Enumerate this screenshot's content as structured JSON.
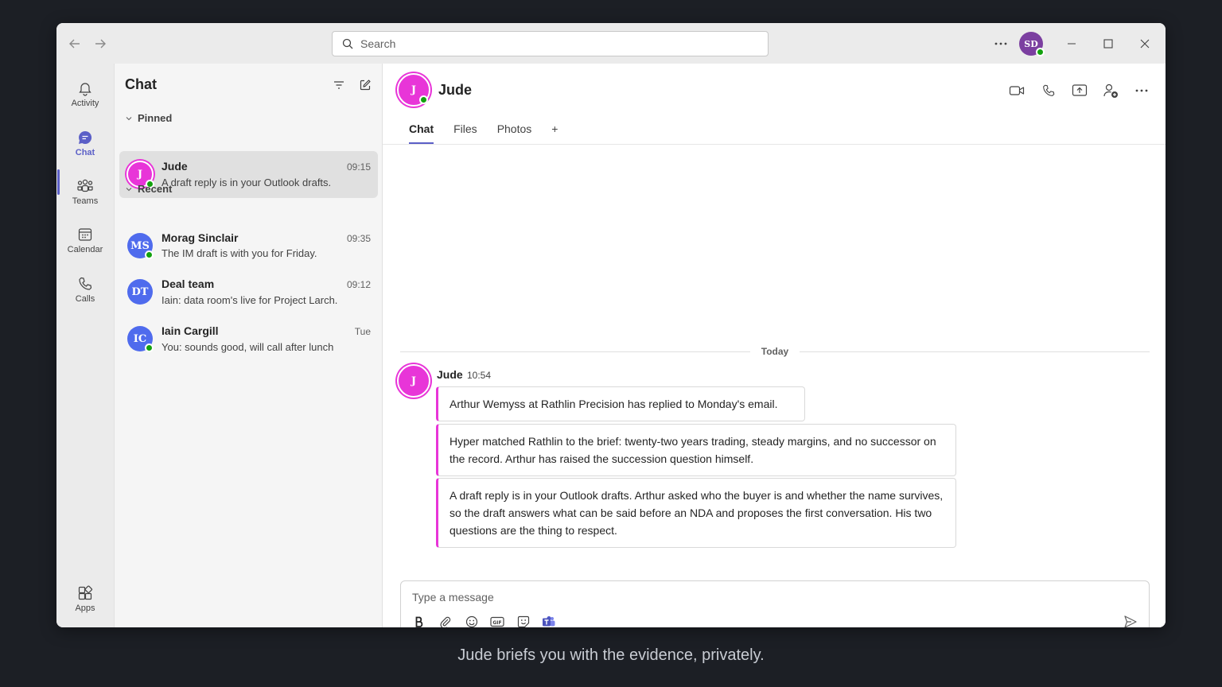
{
  "search": {
    "placeholder": "Search"
  },
  "user": {
    "initials": "SD"
  },
  "rail": {
    "items": [
      {
        "label": "Activity",
        "icon": "bell-icon"
      },
      {
        "label": "Chat",
        "icon": "chat-icon"
      },
      {
        "label": "Teams",
        "icon": "teams-icon"
      },
      {
        "label": "Calendar",
        "icon": "calendar-icon"
      },
      {
        "label": "Calls",
        "icon": "phone-icon"
      },
      {
        "label": "Apps",
        "icon": "apps-icon"
      }
    ]
  },
  "chatlist": {
    "title": "Chat",
    "pinned_label": "Pinned",
    "recent_label": "Recent",
    "pinned": [
      {
        "initials": "J",
        "name": "Jude",
        "time": "09:15",
        "preview": "A draft reply is in your Outlook drafts.",
        "color": "#e835d8"
      }
    ],
    "recent": [
      {
        "initials": "MS",
        "name": "Morag Sinclair",
        "time": "09:35",
        "preview": "The IM draft is with you for Friday.",
        "color": "#4f6bed"
      },
      {
        "initials": "DT",
        "name": "Deal team",
        "time": "09:12",
        "preview": "Iain: data room's live for Project Larch.",
        "color": "#4f6bed"
      },
      {
        "initials": "IC",
        "name": "Iain Cargill",
        "time": "Tue",
        "preview": "You: sounds good, will call after lunch",
        "color": "#4f6bed"
      }
    ]
  },
  "conversation": {
    "initials": "J",
    "name": "Jude",
    "tabs": [
      "Chat",
      "Files",
      "Photos",
      "+"
    ],
    "divider_label": "Today",
    "sender": "Jude",
    "time": "10:54",
    "messages": [
      "Arthur Wemyss at Rathlin Precision has replied to Monday's email.",
      "Hyper matched Rathlin to the brief: twenty-two years trading, steady margins, and no successor on the record. Arthur has raised the succession question himself.",
      "A draft reply is in your Outlook drafts. Arthur asked who the buyer is and whether the name survives, so the draft answers what can be said before an NDA and proposes the first conversation. His two questions are the thing to respect."
    ]
  },
  "composer": {
    "placeholder": "Type a message"
  },
  "caption": "Jude briefs you with the evidence, privately.",
  "colors": {
    "accent": "#5b5fc7",
    "jude": "#e835d8",
    "presence": "#13a10e"
  }
}
